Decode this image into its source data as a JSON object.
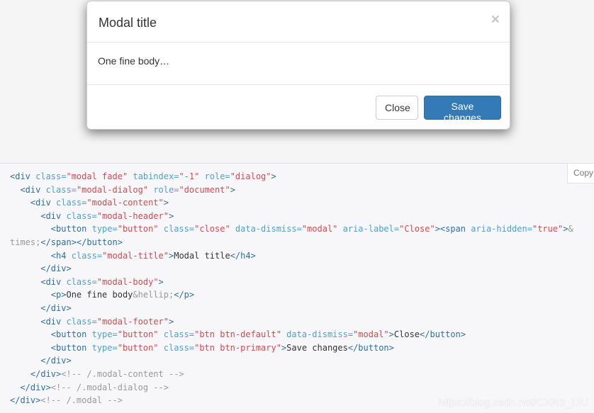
{
  "modal": {
    "title": "Modal title",
    "close_glyph": "×",
    "body_text": "One fine body…",
    "close_button_label": "Close",
    "save_button_label": "Save changes"
  },
  "code_panel": {
    "copy_label": "Copy",
    "lines": [
      [
        {
          "t": "tag",
          "v": "<div "
        },
        {
          "t": "attr",
          "v": "class="
        },
        {
          "t": "val",
          "v": "\"modal fade\""
        },
        {
          "t": "attr",
          "v": " tabindex="
        },
        {
          "t": "val",
          "v": "\"-1\""
        },
        {
          "t": "attr",
          "v": " role="
        },
        {
          "t": "val",
          "v": "\"dialog\""
        },
        {
          "t": "tag",
          "v": ">"
        }
      ],
      [
        {
          "t": "txt",
          "v": "  "
        },
        {
          "t": "tag",
          "v": "<div "
        },
        {
          "t": "attr",
          "v": "class="
        },
        {
          "t": "val",
          "v": "\"modal-dialog\""
        },
        {
          "t": "attr",
          "v": " role="
        },
        {
          "t": "val",
          "v": "\"document\""
        },
        {
          "t": "tag",
          "v": ">"
        }
      ],
      [
        {
          "t": "txt",
          "v": "    "
        },
        {
          "t": "tag",
          "v": "<div "
        },
        {
          "t": "attr",
          "v": "class="
        },
        {
          "t": "val",
          "v": "\"modal-content\""
        },
        {
          "t": "tag",
          "v": ">"
        }
      ],
      [
        {
          "t": "txt",
          "v": "      "
        },
        {
          "t": "tag",
          "v": "<div "
        },
        {
          "t": "attr",
          "v": "class="
        },
        {
          "t": "val",
          "v": "\"modal-header\""
        },
        {
          "t": "tag",
          "v": ">"
        }
      ],
      [
        {
          "t": "txt",
          "v": "        "
        },
        {
          "t": "tag",
          "v": "<button "
        },
        {
          "t": "attr",
          "v": "type="
        },
        {
          "t": "val",
          "v": "\"button\""
        },
        {
          "t": "attr",
          "v": " class="
        },
        {
          "t": "val",
          "v": "\"close\""
        },
        {
          "t": "attr",
          "v": " data-dismiss="
        },
        {
          "t": "val",
          "v": "\"modal\""
        },
        {
          "t": "attr",
          "v": " aria-label="
        },
        {
          "t": "val",
          "v": "\"Close\""
        },
        {
          "t": "tag",
          "v": "><span "
        },
        {
          "t": "attr",
          "v": "aria-hidden="
        },
        {
          "t": "val",
          "v": "\"true\""
        },
        {
          "t": "tag",
          "v": ">"
        },
        {
          "t": "ent",
          "v": "&"
        }
      ],
      [
        {
          "t": "ent",
          "v": "times;"
        },
        {
          "t": "tag",
          "v": "</span></button>"
        }
      ],
      [
        {
          "t": "txt",
          "v": "        "
        },
        {
          "t": "tag",
          "v": "<h4 "
        },
        {
          "t": "attr",
          "v": "class="
        },
        {
          "t": "val",
          "v": "\"modal-title\""
        },
        {
          "t": "tag",
          "v": ">"
        },
        {
          "t": "txt",
          "v": "Modal title"
        },
        {
          "t": "tag",
          "v": "</h4>"
        }
      ],
      [
        {
          "t": "txt",
          "v": "      "
        },
        {
          "t": "tag",
          "v": "</div>"
        }
      ],
      [
        {
          "t": "txt",
          "v": "      "
        },
        {
          "t": "tag",
          "v": "<div "
        },
        {
          "t": "attr",
          "v": "class="
        },
        {
          "t": "val",
          "v": "\"modal-body\""
        },
        {
          "t": "tag",
          "v": ">"
        }
      ],
      [
        {
          "t": "txt",
          "v": "        "
        },
        {
          "t": "tag",
          "v": "<p>"
        },
        {
          "t": "txt",
          "v": "One fine body"
        },
        {
          "t": "ent",
          "v": "&hellip;"
        },
        {
          "t": "tag",
          "v": "</p>"
        }
      ],
      [
        {
          "t": "txt",
          "v": "      "
        },
        {
          "t": "tag",
          "v": "</div>"
        }
      ],
      [
        {
          "t": "txt",
          "v": "      "
        },
        {
          "t": "tag",
          "v": "<div "
        },
        {
          "t": "attr",
          "v": "class="
        },
        {
          "t": "val",
          "v": "\"modal-footer\""
        },
        {
          "t": "tag",
          "v": ">"
        }
      ],
      [
        {
          "t": "txt",
          "v": "        "
        },
        {
          "t": "tag",
          "v": "<button "
        },
        {
          "t": "attr",
          "v": "type="
        },
        {
          "t": "val",
          "v": "\"button\""
        },
        {
          "t": "attr",
          "v": " class="
        },
        {
          "t": "val",
          "v": "\"btn btn-default\""
        },
        {
          "t": "attr",
          "v": " data-dismiss="
        },
        {
          "t": "val",
          "v": "\"modal\""
        },
        {
          "t": "tag",
          "v": ">"
        },
        {
          "t": "txt",
          "v": "Close"
        },
        {
          "t": "tag",
          "v": "</button>"
        }
      ],
      [
        {
          "t": "txt",
          "v": "        "
        },
        {
          "t": "tag",
          "v": "<button "
        },
        {
          "t": "attr",
          "v": "type="
        },
        {
          "t": "val",
          "v": "\"button\""
        },
        {
          "t": "attr",
          "v": " class="
        },
        {
          "t": "val",
          "v": "\"btn btn-primary\""
        },
        {
          "t": "tag",
          "v": ">"
        },
        {
          "t": "txt",
          "v": "Save changes"
        },
        {
          "t": "tag",
          "v": "</button>"
        }
      ],
      [
        {
          "t": "txt",
          "v": "      "
        },
        {
          "t": "tag",
          "v": "</div>"
        }
      ],
      [
        {
          "t": "txt",
          "v": "    "
        },
        {
          "t": "tag",
          "v": "</div>"
        },
        {
          "t": "cmt",
          "v": "<!-- /.modal-content -->"
        }
      ],
      [
        {
          "t": "txt",
          "v": "  "
        },
        {
          "t": "tag",
          "v": "</div>"
        },
        {
          "t": "cmt",
          "v": "<!-- /.modal-dialog -->"
        }
      ],
      [
        {
          "t": "tag",
          "v": "</div>"
        },
        {
          "t": "cmt",
          "v": "<!-- /.modal -->"
        }
      ]
    ]
  },
  "watermark": "https://blog.csdn.net/CXRS_LIU",
  "colors": {
    "primary": "#337ab7",
    "code_tag": "#2f6f9f",
    "code_attr": "#4f9fcf",
    "code_value": "#d44950",
    "code_comment": "#999999"
  }
}
